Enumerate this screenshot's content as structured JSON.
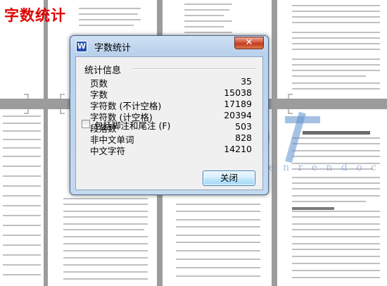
{
  "overlay": {
    "title": "字数统计"
  },
  "watermark": {
    "url_text": "w w w . r e n r e n d o c . c o m"
  },
  "dialog": {
    "title": "字数统计",
    "close_symbol": "✕",
    "group_title": "统计信息",
    "stats": [
      {
        "label": "页数",
        "value": "35"
      },
      {
        "label": "字数",
        "value": "15038"
      },
      {
        "label": "字符数 (不计空格)",
        "value": "17189"
      },
      {
        "label": "字符数 (计空格)",
        "value": "20394"
      },
      {
        "label": "段落数",
        "value": "503"
      },
      {
        "label": "非中文单词",
        "value": "828"
      },
      {
        "label": "中文字符",
        "value": "14210"
      }
    ],
    "checkbox_label": "包括脚注和尾注 (F)",
    "checkbox_checked": false,
    "close_button_label": "关闭"
  },
  "colors": {
    "overlay_title": "#e00000",
    "dialog_frame": "#b9d1ec",
    "app_icon": "#1f4fb1",
    "close_button": "#c3391f"
  },
  "icons": {
    "app": "wps-writer-icon",
    "close": "close-icon"
  }
}
